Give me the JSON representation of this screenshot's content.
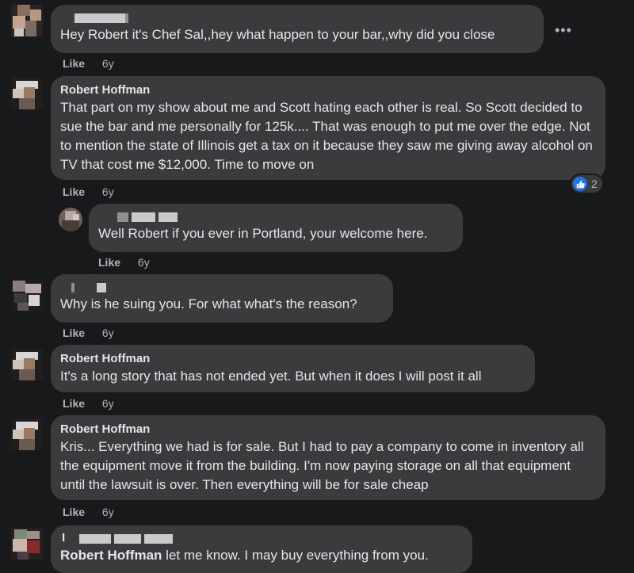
{
  "comments": [
    {
      "author": "",
      "text": "Hey Robert it's Chef Sal,,hey what happen to your bar,,why did you close",
      "like": "Like",
      "time": "6y"
    },
    {
      "author": "Robert Hoffman",
      "text": "That part on my show about me and Scott hating each other is real. So Scott decided to sue the bar and me personally for 125k.... That was enough to put me over the edge. Not to mention the state of Illinois get a tax on it because they saw me giving away alcohol on TV that cost me $12,000. Time to move on",
      "like": "Like",
      "time": "6y",
      "reaction_count": "2"
    },
    {
      "author": "",
      "text": "Well Robert if you ever in Portland, your welcome here.",
      "like": "Like",
      "time": "6y"
    },
    {
      "author": "",
      "text": "Why is he suing you. For what what's the reason?",
      "like": "Like",
      "time": "6y"
    },
    {
      "author": "Robert Hoffman",
      "text": "It's a long story that has not ended yet. But when it does I will post it all",
      "like": "Like",
      "time": "6y"
    },
    {
      "author": "Robert Hoffman",
      "text": "Kris... Everything we had is for sale. But I had to pay a company to come in inventory all the equipment move it from the building. I'm now paying storage on all that equipment until the lawsuit is over. Then everything will be for sale cheap",
      "like": "Like",
      "time": "6y"
    },
    {
      "author": "I",
      "mention": "Robert Hoffman",
      "text": " let me know. I may buy everything from you."
    }
  ],
  "more_label": "•••",
  "colors": {
    "background": "#18191a",
    "bubble": "#3a3b3c",
    "text": "#e4e6eb",
    "meta": "#b0b3b8",
    "like_badge": "#1877f2"
  },
  "icons": [
    "more-options-icon",
    "like-reaction-icon"
  ]
}
